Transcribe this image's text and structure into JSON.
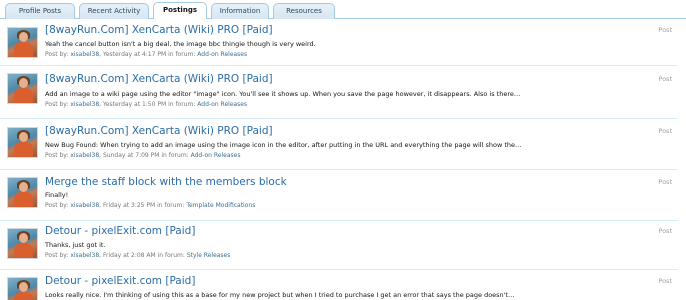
{
  "tabs": [
    {
      "label": "Profile Posts",
      "active": false
    },
    {
      "label": "Recent Activity",
      "active": false
    },
    {
      "label": "Postings",
      "active": true
    },
    {
      "label": "Information",
      "active": false
    },
    {
      "label": "Resources",
      "active": false
    }
  ],
  "items": [
    {
      "title": "[8wayRun.Com] XenCarta (Wiki) PRO [Paid]",
      "snippet": "Yeah the cancel button isn't a big deal, the image bbc thingie though is very weird.",
      "meta": {
        "prefix": "Post by:",
        "user": "xisabel38",
        "time": "Yesterday at 4:17 PM",
        "in": "in forum:",
        "forum": "Add-on Releases"
      },
      "type": "Post"
    },
    {
      "title": "[8wayRun.Com] XenCarta (Wiki) PRO [Paid]",
      "snippet": "Add an image to a wiki page using the editor \"image\" icon. You'll see it shows up. When you save the page however, it disappears. Also is there…",
      "meta": {
        "prefix": "Post by:",
        "user": "xisabel38",
        "time": "Yesterday at 1:50 PM",
        "in": "in forum:",
        "forum": "Add-on Releases"
      },
      "type": "Post"
    },
    {
      "title": "[8wayRun.Com] XenCarta (Wiki) PRO [Paid]",
      "snippet": "New Bug Found: When trying to add an image using the image icon in the editor, after putting in the URL and everything the page will show the…",
      "meta": {
        "prefix": "Post by:",
        "user": "xisabel38",
        "time": "Sunday at 7:09 PM",
        "in": "in forum:",
        "forum": "Add-on Releases"
      },
      "type": "Post"
    },
    {
      "title": "Merge the staff block with the members block",
      "snippet": "Finally!",
      "meta": {
        "prefix": "Post by:",
        "user": "xisabel38",
        "time": "Friday at 3:25 PM",
        "in": "in forum:",
        "forum": "Template Modifications"
      },
      "type": "Post"
    },
    {
      "title": "Detour - pixelExit.com [Paid]",
      "snippet": "Thanks, just got it.",
      "meta": {
        "prefix": "Post by:",
        "user": "xisabel38",
        "time": "Friday at 2:08 AM",
        "in": "in forum:",
        "forum": "Style Releases"
      },
      "type": "Post"
    },
    {
      "title": "Detour - pixelExit.com [Paid]",
      "snippet": "Looks really nice. I'm thinking of using this as a base for my new project but when I tried to purchase I get an error that says the page doesn't…",
      "meta": {
        "prefix": "",
        "user": "",
        "time": "",
        "in": "",
        "forum": ""
      },
      "type": "Post"
    }
  ]
}
